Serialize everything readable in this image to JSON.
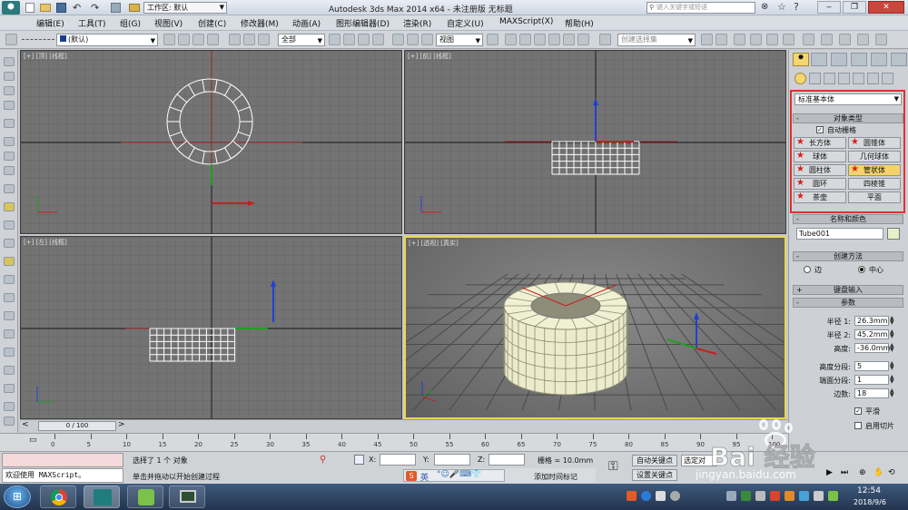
{
  "title_bar": {
    "workspace_label": "工作区: 默认",
    "app_title": "Autodesk 3ds Max  2014 x64   - 未注册版   无标题",
    "search_placeholder": "键入关键字或短语"
  },
  "menu": [
    "编辑(E)",
    "工具(T)",
    "组(G)",
    "视图(V)",
    "创建(C)",
    "修改器(M)",
    "动画(A)",
    "图形编辑器(D)",
    "渲染(R)",
    "自定义(U)",
    "MAXScript(X)",
    "帮助(H)"
  ],
  "toolbar": {
    "layer_combo": "(默认)",
    "filter_combo": "全部",
    "view_combo": "视图",
    "selection_set_placeholder": "创建选择集"
  },
  "viewports": {
    "top": "[+] [顶] [线框]",
    "front": "[+] [前] [线框]",
    "left": "[+] [左] [线框]",
    "perspective": "[+] [透视] [真实]"
  },
  "command_panel": {
    "category": "标准基本体",
    "object_type_header": "对象类型",
    "autogrid_label": "自动栅格",
    "objects": [
      "长方体",
      "圆锥体",
      "球体",
      "几何球体",
      "圆柱体",
      "管状体",
      "圆环",
      "四棱锥",
      "茶壶",
      "平面"
    ],
    "selected_object": "管状体",
    "name_color_header": "名称和颜色",
    "object_name": "Tube001",
    "creation_method_header": "创建方法",
    "creation_options": [
      "边",
      "中心"
    ],
    "creation_selected": "中心",
    "keyboard_entry_header": "键盘输入",
    "params_header": "参数",
    "params": [
      {
        "label": "半径 1:",
        "value": "26.3mm"
      },
      {
        "label": "半径 2:",
        "value": "45.2mm"
      },
      {
        "label": "高度:",
        "value": "-36.0mm"
      },
      {
        "label": "高度分段:",
        "value": "5"
      },
      {
        "label": "端面分段:",
        "value": "1"
      },
      {
        "label": "边数:",
        "value": "18"
      }
    ],
    "smooth_label": "平滑",
    "slice_label": "启用切片"
  },
  "timeline": {
    "frame_label": "0 / 100"
  },
  "ruler": {
    "ticks": [
      "0",
      "5",
      "10",
      "15",
      "20",
      "25",
      "30",
      "35",
      "40",
      "45",
      "50",
      "55",
      "60",
      "65",
      "70",
      "75",
      "80",
      "85",
      "90",
      "95",
      "100"
    ]
  },
  "status": {
    "welcome": "欢迎使用 MAXScript。",
    "selection": "选择了 1 个 对象",
    "prompt": "单击并拖动以开始创建过程",
    "x_label": "X:",
    "y_label": "Y:",
    "z_label": "Z:",
    "grid": "栅格 = 10.0mm",
    "auto_key": "自动关键点",
    "set_key": "设置关键点",
    "selected_obj": "选定对",
    "add_time_tag": "添加时间标记",
    "ime_label": "英"
  },
  "taskbar": {
    "time": "12:54",
    "date": "2018/9/6"
  },
  "watermark": {
    "brand": "Bai 经验",
    "url": "jingyan.baidu.com"
  },
  "colors": {
    "highlight_box": "#e03030",
    "active_viewport": "#e8d84e",
    "selected_button": "#f5d26a",
    "viewport_bg": "#737373"
  }
}
